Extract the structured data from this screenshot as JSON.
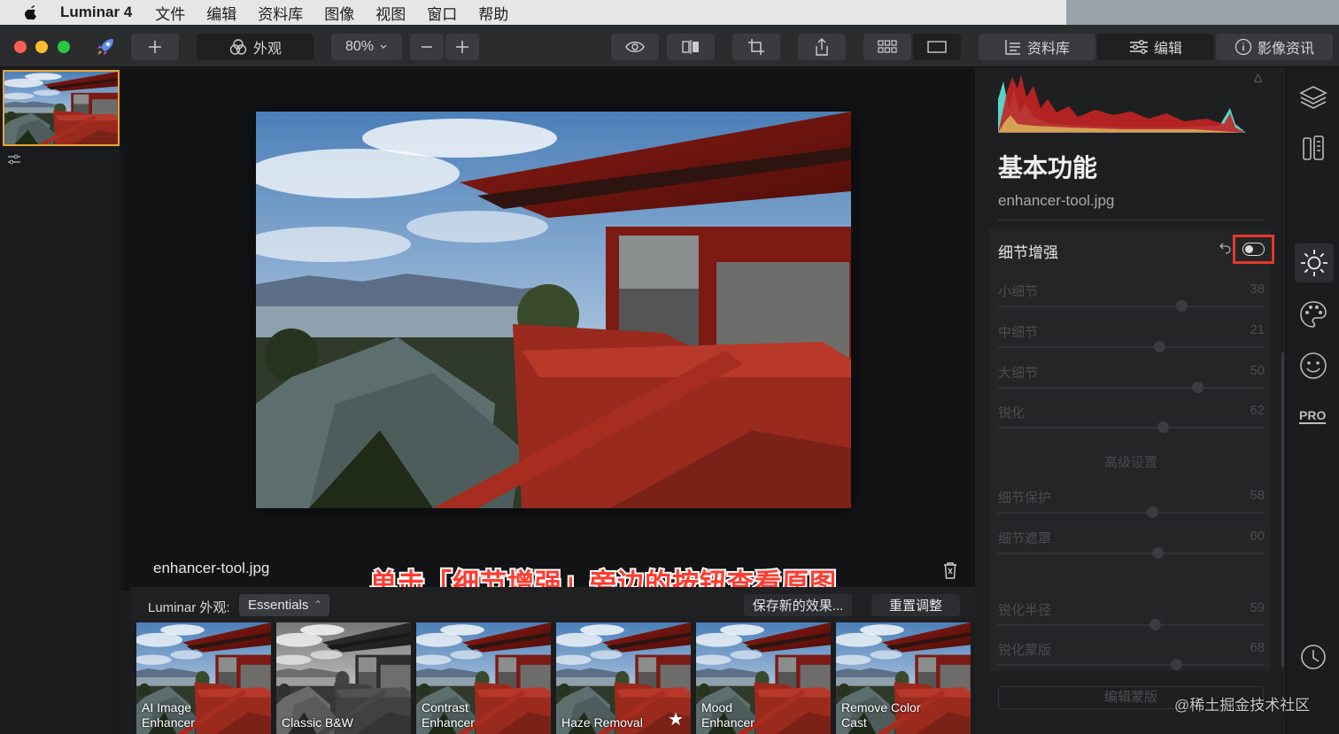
{
  "menubar": {
    "app_name": "Luminar 4",
    "items": [
      "文件",
      "编辑",
      "资料库",
      "图像",
      "视图",
      "窗口",
      "帮助"
    ]
  },
  "toolbar": {
    "looks_label": "外观",
    "zoom": "80%",
    "library_tab": "资料库",
    "edit_tab": "编辑",
    "info_tab": "影像资讯"
  },
  "canvas": {
    "filename": "enhancer-tool.jpg",
    "annotation": "单击「细节增强」旁边的按钮查看原图"
  },
  "looks": {
    "label": "Luminar 外观:",
    "category": "Essentials",
    "save_label": "保存新的效果...",
    "reset_label": "重置调整",
    "tiles": [
      {
        "line1": "AI Image",
        "line2": "Enhancer"
      },
      {
        "line1": "",
        "line2": "Classic B&W"
      },
      {
        "line1": "Contrast",
        "line2": "Enhancer"
      },
      {
        "line1": "",
        "line2": "Haze Removal"
      },
      {
        "line1": "Mood",
        "line2": "Enhancer"
      },
      {
        "line1": "Remove Color",
        "line2": "Cast"
      }
    ]
  },
  "panel": {
    "section_title": "基本功能",
    "file_name": "enhancer-tool.jpg",
    "tool_title": "细节增强",
    "sliders": [
      {
        "label": "小细节",
        "value": "38",
        "level": 0.69
      },
      {
        "label": "中细节",
        "value": "21",
        "level": 0.605
      },
      {
        "label": "大细节",
        "value": "50",
        "level": 0.75
      },
      {
        "label": "锐化",
        "value": "62",
        "level": 0.62
      }
    ],
    "advanced_label": "高级设置",
    "advanced_sliders": [
      {
        "label": "细节保护",
        "value": "58",
        "level": 0.58
      },
      {
        "label": "细节遮罩",
        "value": "60",
        "level": 0.6
      },
      {
        "label": "锐化半径",
        "value": "59",
        "level": 0.59
      },
      {
        "label": "锐化蒙版",
        "value": "68",
        "level": 0.67
      }
    ],
    "mask_label": "编辑蒙版"
  },
  "watermark": "@稀土掘金技术社区",
  "colors": {
    "accent_highlight": "#e8362c",
    "thumb_border": "#e8a43a",
    "annotation_text": "#ff3b2f"
  }
}
